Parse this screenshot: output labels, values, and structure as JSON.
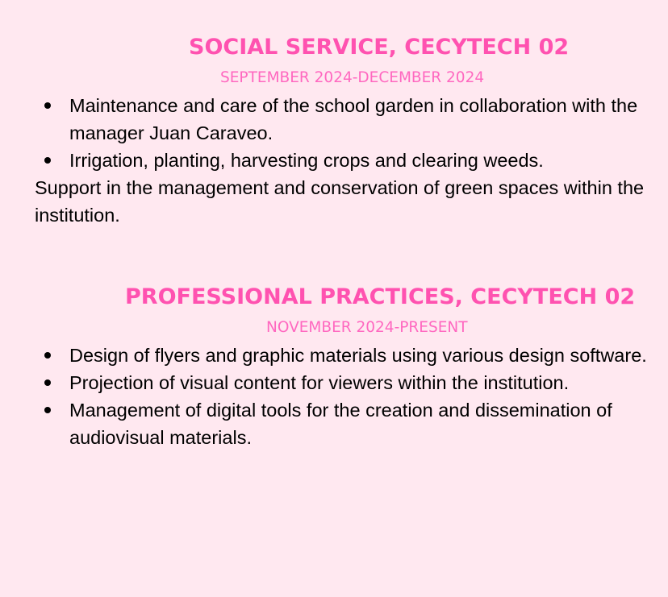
{
  "sections": [
    {
      "title": "SOCIAL SERVICE, CECYTECH 02",
      "date": "SEPTEMBER 2024-DECEMBER 2024",
      "bullets": [
        "Maintenance and care of the school garden in collaboration with the manager Juan Caraveo.",
        "Irrigation, planting, harvesting crops and clearing weeds."
      ],
      "paragraph": "Support in the management and conservation of green spaces within the institution."
    },
    {
      "title": "PROFESSIONAL PRACTICES, CECYTECH 02",
      "date": "NOVEMBER 2024-PRESENT",
      "bullets": [
        "Design of flyers and graphic materials using various design software.",
        "Projection of visual content for viewers within the institution.",
        "Management of digital tools for the creation and dissemination of audiovisual materials."
      ]
    }
  ],
  "colors": {
    "background": "#ffe8f0",
    "title": "#ff52b0",
    "date": "#ff68c0",
    "body_text": "#000000"
  }
}
